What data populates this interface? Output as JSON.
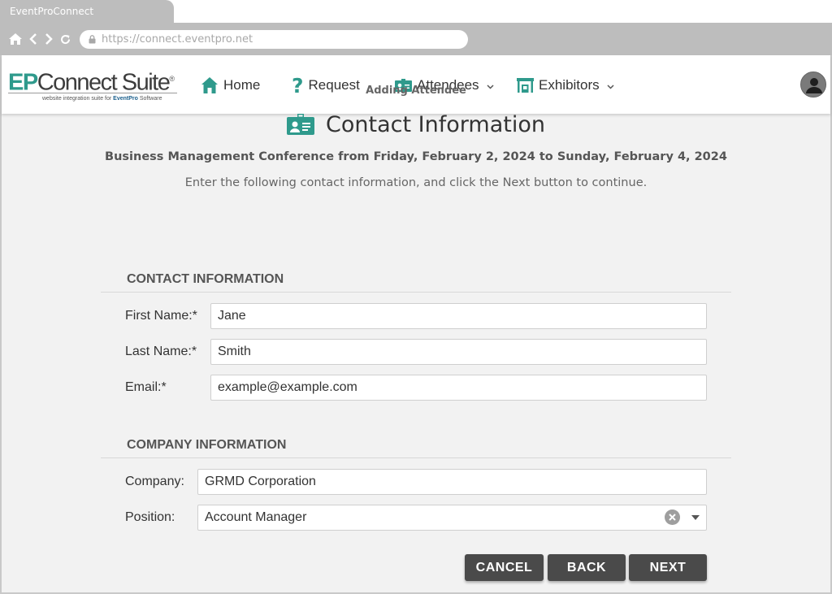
{
  "browser": {
    "tab_title": "EventProConnect",
    "url": "https://connect.eventpro.net"
  },
  "header": {
    "logo_brand_a": "EP",
    "logo_brand_b": "Connect Suite",
    "logo_registered": "®",
    "logo_tagline_prefix": "website integration suite for",
    "logo_tagline_brand": "EventPro",
    "logo_tagline_suffix": "Software",
    "nav": {
      "home": "Home",
      "request": "Request",
      "attendees": "Attendees",
      "exhibitors": "Exhibitors"
    }
  },
  "page": {
    "eyebrow": "Adding Attendee",
    "title": "Contact Information",
    "event_line": "Business Management Conference from Friday, February 2, 2024 to Sunday, February 4, 2024",
    "instructions": "Enter the following contact information, and click the Next button to continue."
  },
  "contact_section": {
    "heading": "CONTACT INFORMATION",
    "first_name_label": "First Name:*",
    "first_name_value": "Jane",
    "last_name_label": "Last Name:*",
    "last_name_value": "Smith",
    "email_label": "Email:*",
    "email_value": "example@example.com"
  },
  "company_section": {
    "heading": "COMPANY INFORMATION",
    "company_label": "Company:",
    "company_value": "GRMD Corporation",
    "position_label": "Position:",
    "position_value": "Account Manager"
  },
  "buttons": {
    "cancel": "CANCEL",
    "back": "BACK",
    "next": "NEXT"
  },
  "colors": {
    "brand_teal": "#2f9a8c",
    "button_dark": "#4a4a4a",
    "chrome_gray": "#bdbdbd"
  }
}
